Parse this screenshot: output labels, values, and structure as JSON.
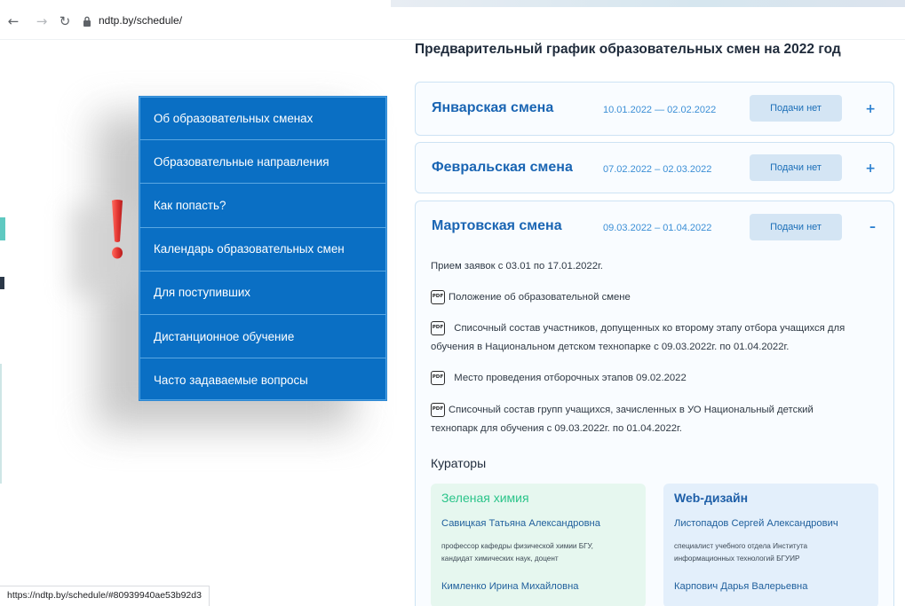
{
  "browser": {
    "url": "ndtp.by/schedule/",
    "status_url": "https://ndtp.by/schedule/#80939940ae53b92d3"
  },
  "menu": {
    "items": [
      {
        "label": "Об образовательных сменах"
      },
      {
        "label": "Образовательные направления"
      },
      {
        "label": "Как попасть?"
      },
      {
        "label": "Календарь образовательных смен"
      },
      {
        "label": "Для поступивших"
      },
      {
        "label": "Дистанционное обучение"
      },
      {
        "label": "Часто задаваемые вопросы"
      }
    ],
    "color": "#0a6fc4"
  },
  "annotation": {
    "color": "#e53935"
  },
  "main": {
    "title": "Предварительный график образовательных смен на 2022 год",
    "shifts": [
      {
        "title": "Январская смена",
        "dates": "10.01.2022 — 02.02.2022",
        "status": "Подачи нет",
        "toggle": "+"
      },
      {
        "title": "Февральская смена",
        "dates": "07.02.2022 – 02.03.2022",
        "status": "Подачи нет",
        "toggle": "+"
      },
      {
        "title": "Мартовская смена",
        "dates": "09.03.2022 – 01.04.2022",
        "status": "Подачи нет",
        "toggle": "–"
      }
    ],
    "march_details": {
      "intake": "Прием заявок с 03.01 по 17.01.2022г.",
      "docs": [
        {
          "icon": "pdf-icon",
          "text": "Положение об образовательной смене"
        },
        {
          "icon": "pdf-icon",
          "text_line1": "Списочный состав участников, допущенных ко второму этапу отбора учащихся для",
          "text_line2": "обучения в Национальном детском технопарке с 09.03.2022г. по 01.04.2022г."
        },
        {
          "icon": "pdf-icon",
          "text": "Место проведения отборочных этапов 09.02.2022"
        },
        {
          "icon": "pdf-icon",
          "text_line1": "Списочный состав групп учащихся, зачисленных в УО Национальный детский",
          "text_line2": "технопарк для обучения с 09.03.2022г. по 01.04.2022г."
        }
      ],
      "pdf_label": "PDF"
    },
    "curators": {
      "title": "Кураторы",
      "cards": [
        {
          "direction": "Зеленая химия",
          "person1": "Савицкая Татьяна Александровна",
          "desc1_line1": "профессор кафедры физической химии БГУ,",
          "desc1_line2": "кандидат химических наук, доцент",
          "person2": "Кимленко Ирина Михайловна",
          "bg": "#e6f7ef",
          "accent": "#2bc48a"
        },
        {
          "direction": "Web-дизайн",
          "person1": "Листопадов Сергей Александрович",
          "desc1_line1": "специалист учебного отдела Института",
          "desc1_line2": "информационных технологий БГУИР",
          "person2": "Карпович Дарья Валерьевна",
          "bg": "#e3effb",
          "accent": "#1e5fa8"
        }
      ]
    }
  }
}
